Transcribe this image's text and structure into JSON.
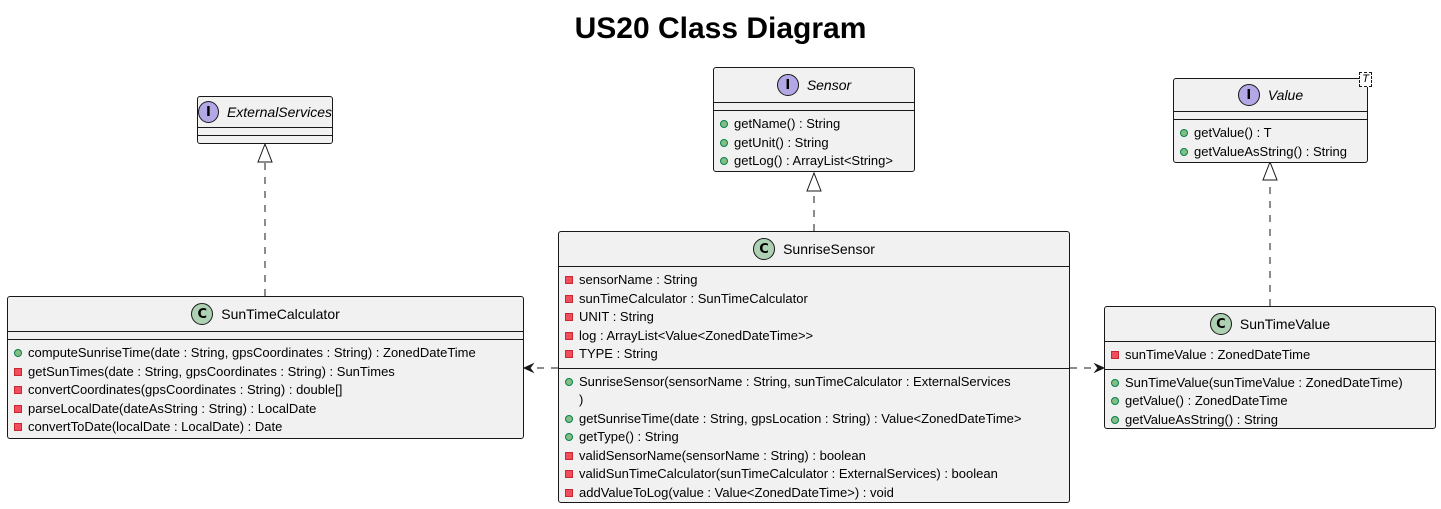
{
  "diagram": {
    "title": "US20 Class Diagram",
    "colors": {
      "box_fill": "#f1f1f1",
      "border": "#181818",
      "class_badge": "#add1b2",
      "interface_badge": "#b4a7e5",
      "public_marker": "#84be84",
      "private_marker": "#f24d5c"
    },
    "elements": {
      "external_services": {
        "kind": "interface",
        "badge": "I",
        "name": "ExternalServices",
        "fields": [],
        "methods": []
      },
      "sensor": {
        "kind": "interface",
        "badge": "I",
        "name": "Sensor",
        "fields": [],
        "methods": [
          {
            "vis": "public",
            "text": "getName() : String"
          },
          {
            "vis": "public",
            "text": "getUnit() : String"
          },
          {
            "vis": "public",
            "text": "getLog() : ArrayList<String>"
          }
        ]
      },
      "value": {
        "kind": "interface",
        "badge": "I",
        "name": "Value",
        "generic": "T",
        "fields": [],
        "methods": [
          {
            "vis": "public",
            "text": "getValue() : T"
          },
          {
            "vis": "public",
            "text": "getValueAsString() : String"
          }
        ]
      },
      "sun_time_calculator": {
        "kind": "class",
        "badge": "C",
        "name": "SunTimeCalculator",
        "fields": [],
        "methods": [
          {
            "vis": "public",
            "text": "computeSunriseTime(date : String, gpsCoordinates : String) : ZonedDateTime"
          },
          {
            "vis": "private",
            "text": "getSunTimes(date : String, gpsCoordinates : String) : SunTimes"
          },
          {
            "vis": "private",
            "text": "convertCoordinates(gpsCoordinates : String) : double[]"
          },
          {
            "vis": "private",
            "text": "parseLocalDate(dateAsString : String) : LocalDate"
          },
          {
            "vis": "private",
            "text": "convertToDate(localDate : LocalDate) : Date"
          }
        ]
      },
      "sunrise_sensor": {
        "kind": "class",
        "badge": "C",
        "name": "SunriseSensor",
        "fields": [
          {
            "vis": "private",
            "text": "sensorName : String"
          },
          {
            "vis": "private",
            "text": "sunTimeCalculator : SunTimeCalculator"
          },
          {
            "vis": "private",
            "text": "UNIT : String"
          },
          {
            "vis": "private",
            "text": "log : ArrayList<Value<ZonedDateTime>>"
          },
          {
            "vis": "private",
            "text": "TYPE : String"
          }
        ],
        "methods": [
          {
            "vis": "public",
            "text": "SunriseSensor(sensorName : String, sunTimeCalculator : ExternalServices"
          },
          {
            "vis": "none",
            "text": ")"
          },
          {
            "vis": "public",
            "text": "getSunriseTime(date : String, gpsLocation : String) : Value<ZonedDateTime>"
          },
          {
            "vis": "public",
            "text": "getType() : String"
          },
          {
            "vis": "private",
            "text": "validSensorName(sensorName : String) : boolean"
          },
          {
            "vis": "private",
            "text": "validSunTimeCalculator(sunTimeCalculator : ExternalServices) : boolean"
          },
          {
            "vis": "private",
            "text": "addValueToLog(value : Value<ZonedDateTime>) : void"
          }
        ]
      },
      "sun_time_value": {
        "kind": "class",
        "badge": "C",
        "name": "SunTimeValue",
        "fields": [
          {
            "vis": "private",
            "text": "sunTimeValue : ZonedDateTime"
          }
        ],
        "methods": [
          {
            "vis": "public",
            "text": "SunTimeValue(sunTimeValue : ZonedDateTime)"
          },
          {
            "vis": "public",
            "text": "getValue() : ZonedDateTime"
          },
          {
            "vis": "public",
            "text": "getValueAsString() : String"
          }
        ]
      }
    },
    "relations": [
      {
        "from": "sun_time_calculator",
        "to": "external_services",
        "type": "realization"
      },
      {
        "from": "sunrise_sensor",
        "to": "sensor",
        "type": "realization"
      },
      {
        "from": "sun_time_value",
        "to": "value",
        "type": "realization"
      },
      {
        "from": "sunrise_sensor",
        "to": "sun_time_calculator",
        "type": "dependency"
      },
      {
        "from": "sunrise_sensor",
        "to": "sun_time_value",
        "type": "dependency"
      }
    ]
  }
}
